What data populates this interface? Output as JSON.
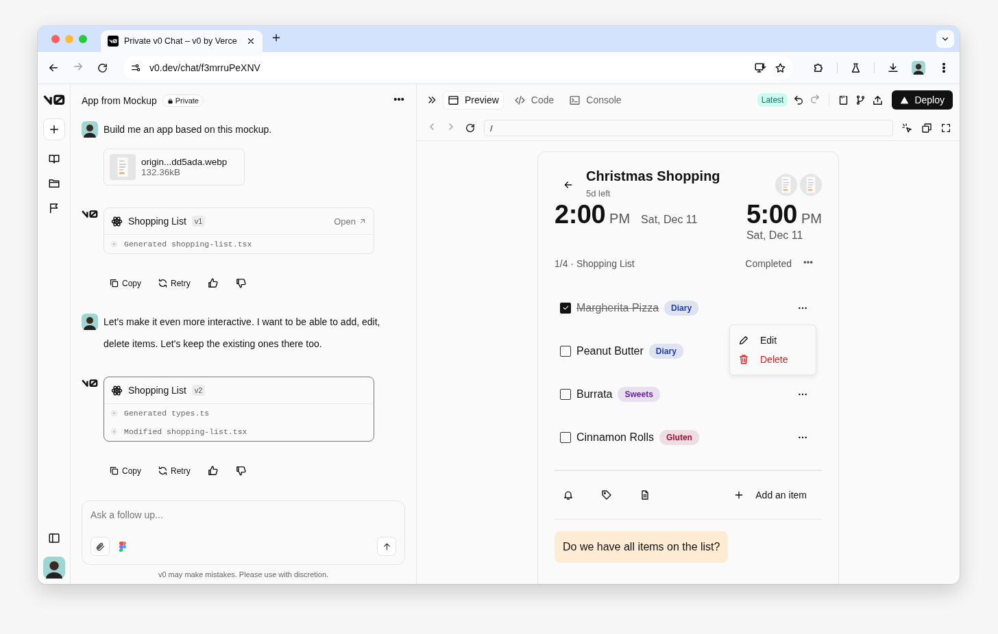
{
  "browser": {
    "tab_title": "Private v0 Chat – v0 by Verce",
    "url": "v0.dev/chat/f3mrruPeXNV"
  },
  "chat": {
    "title": "App from Mockup",
    "badge": "Private",
    "messages": [
      {
        "kind": "user",
        "text": "Build me an app based on this mockup.",
        "attachment": {
          "name": "origin...dd5ada.webp",
          "size": "132.36kB"
        }
      },
      {
        "kind": "assistant",
        "card": {
          "title": "Shopping List",
          "version": "v1",
          "open_label": "Open",
          "selected": false,
          "steps": [
            "Generated shopping-list.tsx"
          ]
        },
        "actions": [
          "Copy",
          "Retry"
        ]
      },
      {
        "kind": "user",
        "text": "Let's make it even more interactive. I want to be able to add, edit, delete items. Let's keep the existing ones there too."
      },
      {
        "kind": "assistant",
        "card": {
          "title": "Shopping List",
          "version": "v2",
          "selected": true,
          "steps": [
            "Generated types.ts",
            "Modified shopping-list.tsx"
          ]
        },
        "actions": [
          "Copy",
          "Retry"
        ]
      }
    ],
    "composer": {
      "placeholder": "Ask a follow up..."
    },
    "disclaimer": "v0 may make mistakes. Please use with discretion."
  },
  "preview": {
    "tabs": [
      {
        "label": "Preview",
        "kind": "window",
        "selected": true
      },
      {
        "label": "Code",
        "kind": "code",
        "selected": false
      },
      {
        "label": "Console",
        "kind": "terminal",
        "selected": false
      }
    ],
    "badge": "Latest",
    "deploy": "Deploy",
    "path": "/"
  },
  "app": {
    "title": "Christmas Shopping",
    "subtitle": "5d left",
    "start": {
      "time": "2:00",
      "ampm": "PM",
      "date": "Sat, Dec 11"
    },
    "end": {
      "time": "5:00",
      "ampm": "PM",
      "date": "Sat, Dec 11"
    },
    "progress": "1/4 · Shopping List",
    "status": "Completed",
    "items": [
      {
        "name": "Margherita Pizza",
        "tag": "Diary",
        "color": "#1e40af",
        "checked": true,
        "menu_open": false
      },
      {
        "name": "Peanut Butter",
        "tag": "Diary",
        "color": "#1e40af",
        "checked": false,
        "menu_open": true
      },
      {
        "name": "Burrata",
        "tag": "Sweets",
        "color": "#6b21a8",
        "checked": false,
        "menu_open": false
      },
      {
        "name": "Cinnamon Rolls",
        "tag": "Gluten",
        "color": "#9f1239",
        "checked": false,
        "menu_open": false
      }
    ],
    "menu": [
      {
        "label": "Edit",
        "kind": "edit"
      },
      {
        "label": "Delete",
        "kind": "delete"
      }
    ],
    "add_label": "Add an item",
    "question": "Do we have all items on the list?"
  }
}
